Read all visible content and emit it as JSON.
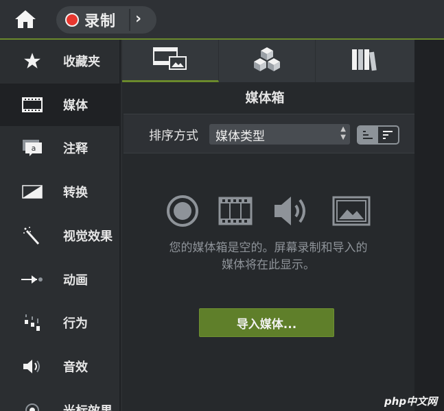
{
  "topbar": {
    "home_icon": "home-icon",
    "record_label": "录制",
    "record_color": "#e8372f",
    "expand_icon": "chevron-right-icon"
  },
  "sidebar": {
    "items": [
      {
        "label": "收藏夹",
        "icon": "star-icon"
      },
      {
        "label": "媒体",
        "icon": "film-icon"
      },
      {
        "label": "注释",
        "icon": "callout-icon"
      },
      {
        "label": "转换",
        "icon": "transition-icon"
      },
      {
        "label": "视觉效果",
        "icon": "magic-wand-icon"
      },
      {
        "label": "动画",
        "icon": "animation-arrow-icon"
      },
      {
        "label": "行为",
        "icon": "behavior-icon"
      },
      {
        "label": "音效",
        "icon": "speaker-icon"
      },
      {
        "label": "光标效果",
        "icon": "cursor-icon"
      }
    ],
    "active_index": 1
  },
  "tabs": [
    {
      "icon": "media-bin-icon"
    },
    {
      "icon": "library-cubes-icon"
    },
    {
      "icon": "books-icon"
    }
  ],
  "panel": {
    "title": "媒体箱",
    "sort": {
      "label": "排序方式",
      "value": "媒体类型"
    },
    "empty_message_line1": "您的媒体箱是空的。屏幕录制和导入的",
    "empty_message_line2": "媒体将在此显示。",
    "import_button": "导入媒体..."
  },
  "colors": {
    "accent": "#6b8a2c",
    "button": "#5f7f2a",
    "background": "#2b2e31"
  },
  "watermark": "php中文网"
}
